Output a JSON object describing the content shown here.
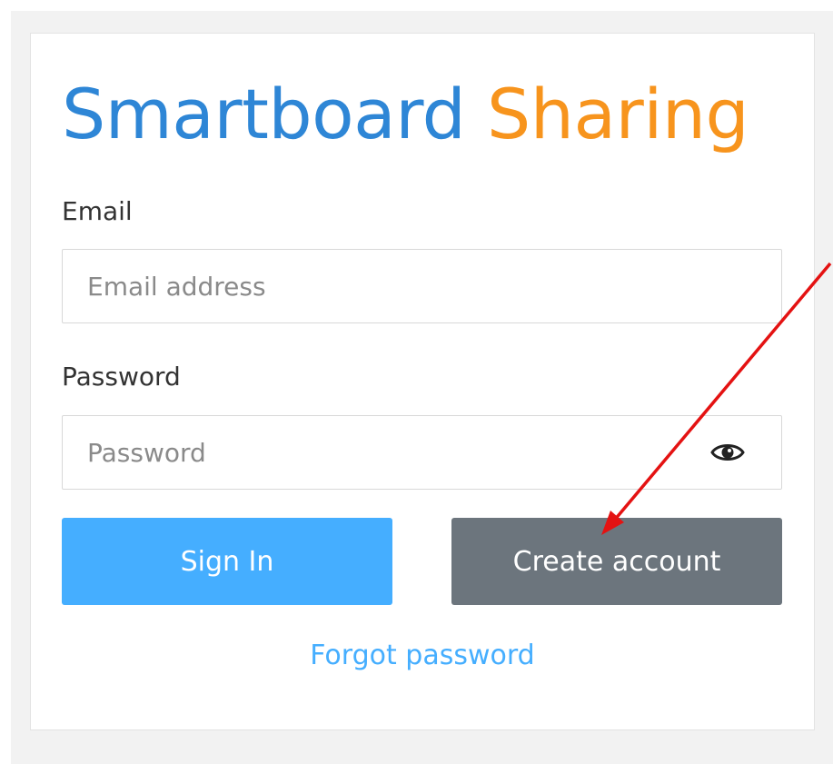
{
  "colors": {
    "title_primary": "#2e86d6",
    "title_accent": "#f7941d",
    "signin_button": "#45aeff",
    "create_button": "#6c757d",
    "link": "#45aeff",
    "annotation_arrow": "#e41212"
  },
  "header": {
    "title_part1": "Smartboard",
    "title_part2": "Sharing"
  },
  "form": {
    "email_label": "Email",
    "email_placeholder": "Email address",
    "email_value": "",
    "password_label": "Password",
    "password_placeholder": "Password",
    "password_value": "",
    "password_toggle_icon": "eye-icon"
  },
  "actions": {
    "signin_label": "Sign In",
    "create_label": "Create account",
    "forgot_label": "Forgot password"
  },
  "annotation": {
    "type": "arrow",
    "points_to": "create-account-button"
  }
}
